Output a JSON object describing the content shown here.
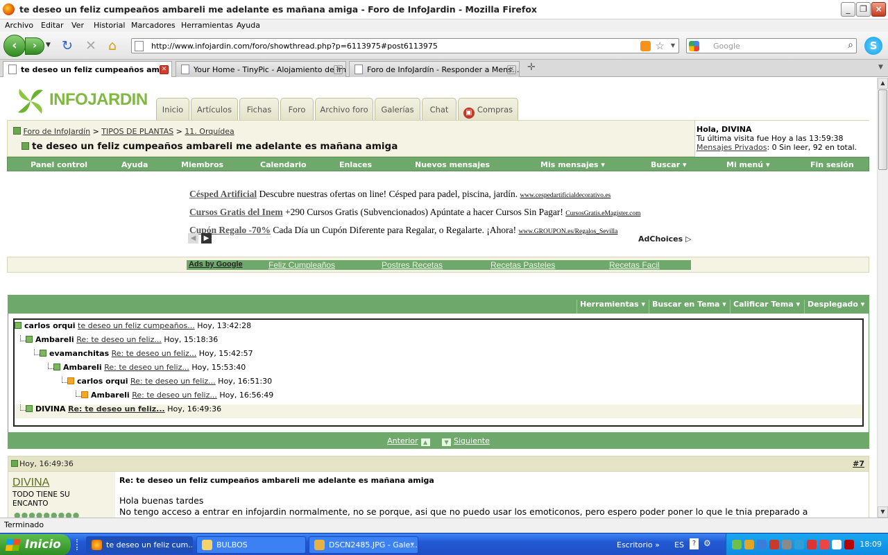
{
  "window": {
    "title": "te deseo un feliz cumpeaños ambareli me adelante es mañana amiga - Foro de InfoJardin - Mozilla Firefox"
  },
  "menu": [
    "Archivo",
    "Editar",
    "Ver",
    "Historial",
    "Marcadores",
    "Herramientas",
    "Ayuda"
  ],
  "address": {
    "url": "http://www.infojardin.com/foro/showthread.php?p=6113975#post6113975"
  },
  "search": {
    "placeholder": "Google"
  },
  "tabs": [
    {
      "label": "te deseo un feliz cumpeaños am...",
      "active": true
    },
    {
      "label": "Your Home - TinyPic - Alojamiento de im...",
      "active": false
    },
    {
      "label": "Foro de InfoJardín - Responder a Mens...",
      "active": false
    }
  ],
  "site": {
    "logo": "INFOJARDIN",
    "nav_tabs": [
      "Inicio",
      "Artículos",
      "Fichas",
      "Foro",
      "Archivo foro",
      "Galerías",
      "Chat",
      "Compras"
    ],
    "breadcrumb": [
      "Foro de InfoJardín",
      "TIPOS DE PLANTAS",
      "11. Orquídea"
    ],
    "breadcrumb_sep": ">",
    "thread_title": "te deseo un feliz cumpeaños ambareli me adelante es mañana amiga",
    "greeting": {
      "hello": "Hola, DIVINA",
      "last_visit": "Tu última visita fue Hoy a las 13:59:38",
      "pm_link": "Mensajes Privados",
      "pm_status": ": 0 Sin leer, 92 en total."
    },
    "green_nav": [
      "Panel control",
      "Ayuda",
      "Miembros",
      "Calendario",
      "Enlaces",
      "Nuevos mensajes",
      "Mis mensajes ▾",
      "Buscar ▾",
      "Mi menú ▾",
      "Fin sesión"
    ]
  },
  "ads": [
    {
      "title": "Césped Artificial",
      "text": "Descubre nuestras ofertas on line! Césped para padel, piscina, jardín.",
      "url": "www.cespedartificialdecorativo.es"
    },
    {
      "title": "Cursos Gratis del Inem",
      "text": "+290 Cursos Gratis (Subvencionados) Apúntate a hacer Cursos Sin Pagar!",
      "url": "CursosGratis.eMagister.com"
    },
    {
      "title": "Cupón Regalo -70%",
      "text": "Cada Día un Cupón Diferente para Regalar, o Regalarte. ¡Ahora!",
      "url": "www.GROUPON.es/Regalos_Sevilla"
    }
  ],
  "adchoices": "AdChoices",
  "ad_links": {
    "label": "Ads by Google",
    "links": [
      "Feliz Cumpleaños",
      "Postres Recetas",
      "Recetas Pasteles",
      "Recetas Facil"
    ]
  },
  "thread_tools": [
    "Herramientas ▾",
    "Buscar en Tema ▾",
    "Calificar Tema ▾",
    "Desplegado ▾"
  ],
  "tree": [
    {
      "user": "carlos orqui",
      "link": "te deseo un feliz cumpeaños...",
      "time": "Hoy, 13:42:28",
      "depth": 0,
      "icon": "green"
    },
    {
      "user": "Ambareli",
      "link": "Re: te deseo un feliz...",
      "time": "Hoy, 15:18:36",
      "depth": 1,
      "icon": "green"
    },
    {
      "user": "evamanchitas",
      "link": "Re: te deseo un feliz...",
      "time": "Hoy, 15:42:57",
      "depth": 2,
      "icon": "green"
    },
    {
      "user": "Ambareli",
      "link": "Re: te deseo un feliz...",
      "time": "Hoy, 15:53:40",
      "depth": 3,
      "icon": "green"
    },
    {
      "user": "carlos orqui",
      "link": "Re: te deseo un feliz...",
      "time": "Hoy, 16:51:30",
      "depth": 4,
      "icon": "orange"
    },
    {
      "user": "Ambareli",
      "link": "Re: te deseo un feliz...",
      "time": "Hoy, 16:56:49",
      "depth": 5,
      "icon": "orange"
    },
    {
      "user": "DIVINA",
      "link": "Re: te deseo un feliz...",
      "time": "Hoy, 16:49:36",
      "depth": 1,
      "icon": "green",
      "selected": true
    }
  ],
  "pager": {
    "prev": "Anterior",
    "next": "Siguiente"
  },
  "post": {
    "date": "Hoy, 16:49:36",
    "number": "#7",
    "username": "DIVINA",
    "user_title": "TODO TIENE SU ENCANTO",
    "title": "Re: te deseo un feliz cumpeaños ambareli me adelante es mañana amiga",
    "line1": "Hola buenas tardes",
    "line2": "No tengo acceso a entrar en infojardin normalmente, no se porque, asi que no puedo usar los emoticonos, pero espero poder poner lo que le tnia preparado a"
  },
  "status": "Terminado",
  "taskbar": {
    "start": "Inicio",
    "items": [
      "te deseo un feliz cum...",
      "BULBOS",
      "DSCN2485.JPG - Gale..."
    ],
    "desktop": "Escritorio",
    "lang": "ES",
    "clock": "18:09"
  },
  "colors": {
    "site_green": "#6ea96b",
    "site_cream": "#f4f3e4",
    "logo_green": "#7fb93f",
    "taskbar_blue": "#2259d3"
  }
}
